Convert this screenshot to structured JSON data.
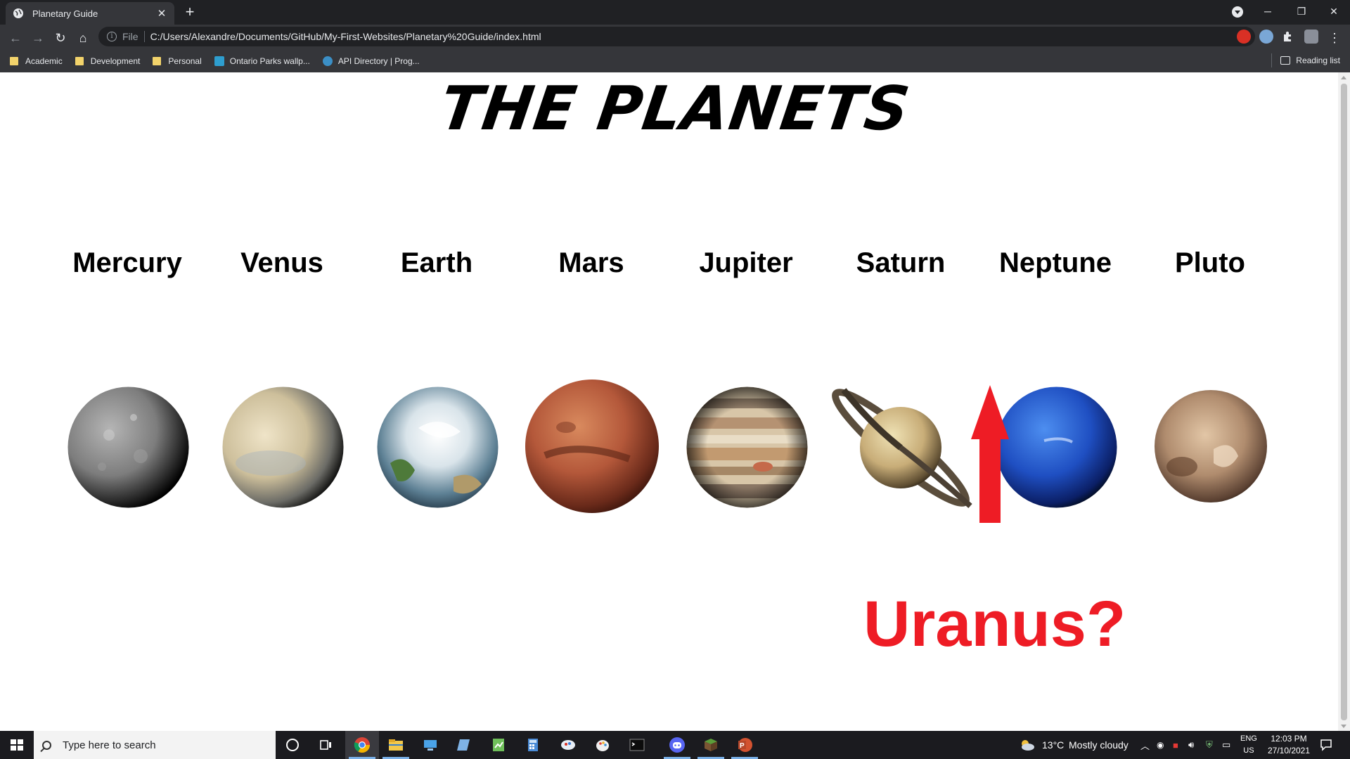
{
  "browser": {
    "tab_title": "Planetary Guide",
    "url_scheme": "File",
    "url": "C:/Users/Alexandre/Documents/GitHub/My-First-Websites/Planetary%20Guide/index.html",
    "bookmarks": [
      "Academic",
      "Development",
      "Personal",
      "Ontario Parks wallp...",
      "API Directory | Prog..."
    ],
    "reading_list": "Reading list"
  },
  "page": {
    "title": "THE PLANETS",
    "planets": [
      "Mercury",
      "Venus",
      "Earth",
      "Mars",
      "Jupiter",
      "Saturn",
      "Neptune",
      "Pluto"
    ],
    "annotation": "Uranus?",
    "annotation_color": "#ee1c25"
  },
  "taskbar": {
    "search_placeholder": "Type here to search",
    "weather_temp": "13°C",
    "weather_text": "Mostly cloudy",
    "lang_line1": "ENG",
    "lang_line2": "US",
    "time": "12:03 PM",
    "date": "27/10/2021"
  }
}
